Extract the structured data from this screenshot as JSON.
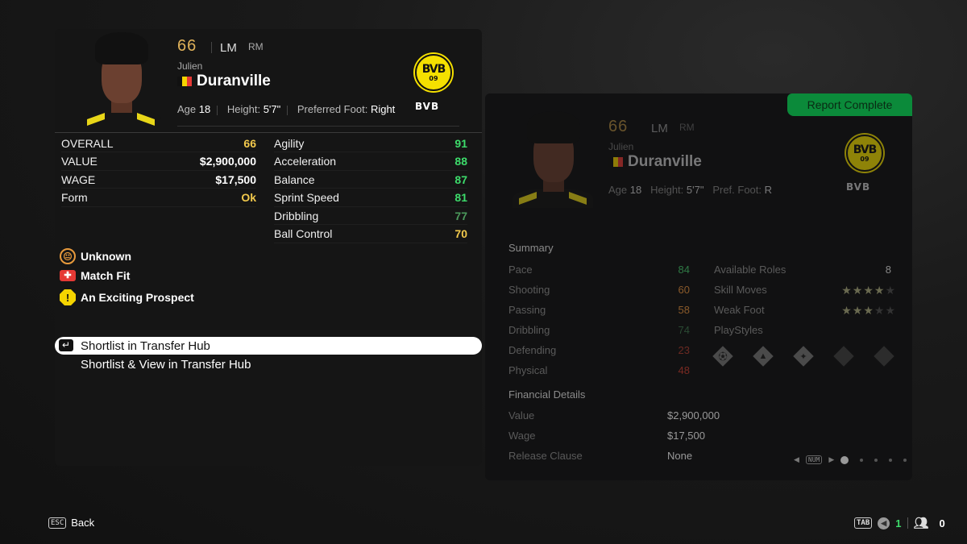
{
  "player": {
    "rating": "66",
    "position_main": "LM",
    "position_alt": "RM",
    "first_name": "Julien",
    "last_name": "Duranville",
    "nationality_flag": [
      "#111111",
      "#f5d400",
      "#e53935"
    ],
    "age_label": "Age",
    "age": "18",
    "height_label": "Height:",
    "height": "5'7\"",
    "foot_label": "Preferred Foot:",
    "foot": "Right",
    "club_abbr": "BVB",
    "club_logo_top": "BVB",
    "club_logo_bottom": "09"
  },
  "overview_stats": [
    {
      "label": "OVERALL",
      "value": "66",
      "color": "#f2c94c"
    },
    {
      "label": "VALUE",
      "value": "$2,900,000",
      "color": "#ffffff"
    },
    {
      "label": "WAGE",
      "value": "$17,500",
      "color": "#ffffff"
    },
    {
      "label": "Form",
      "value": "Ok",
      "color": "#f2c94c"
    }
  ],
  "attributes": [
    {
      "label": "Agility",
      "value": "91",
      "color": "#3ddc6b"
    },
    {
      "label": "Acceleration",
      "value": "88",
      "color": "#3ddc6b"
    },
    {
      "label": "Balance",
      "value": "87",
      "color": "#3ddc6b"
    },
    {
      "label": "Sprint Speed",
      "value": "81",
      "color": "#3ddc6b"
    },
    {
      "label": "Dribbling",
      "value": "77",
      "color": "#4c9a5c"
    },
    {
      "label": "Ball Control",
      "value": "70",
      "color": "#f2c94c"
    }
  ],
  "statuses": [
    {
      "icon": "neutral-face-icon",
      "label": "Unknown",
      "color": "#e89a3c"
    },
    {
      "icon": "ambulance-icon",
      "label": "Match Fit",
      "color": "#e53935"
    },
    {
      "icon": "warning-icon",
      "label": "An Exciting Prospect",
      "color": "#f5d400"
    }
  ],
  "actions": [
    {
      "label": "Shortlist in Transfer Hub",
      "selected": true
    },
    {
      "label": "Shortlist & View in Transfer Hub",
      "selected": false
    }
  ],
  "report": {
    "badge": "Report Complete",
    "foot_label": "Pref. Foot:",
    "foot": "R",
    "summary_title": "Summary",
    "summary": [
      {
        "label": "Pace",
        "value": "84",
        "color": "#2f7a45"
      },
      {
        "label": "Shooting",
        "value": "60",
        "color": "#8a5a2a"
      },
      {
        "label": "Passing",
        "value": "58",
        "color": "#8a5a2a"
      },
      {
        "label": "Dribbling",
        "value": "74",
        "color": "#2a4a33"
      },
      {
        "label": "Defending",
        "value": "23",
        "color": "#6b2a22"
      },
      {
        "label": "Physical",
        "value": "48",
        "color": "#7a2a22"
      }
    ],
    "available_roles_label": "Available Roles",
    "available_roles": "8",
    "skill_moves_label": "Skill Moves",
    "skill_moves": 4,
    "weak_foot_label": "Weak Foot",
    "weak_foot": 3,
    "playstyles_label": "PlayStyles",
    "playstyles": [
      "first-touch-icon",
      "rapid-icon",
      "technical-icon",
      "empty",
      "empty"
    ],
    "financial_title": "Financial Details",
    "financial": [
      {
        "label": "Value",
        "value": "$2,900,000"
      },
      {
        "label": "Wage",
        "value": "$17,500"
      },
      {
        "label": "Release Clause",
        "value": "None"
      }
    ],
    "pager_key": "NUM",
    "pages": 5,
    "current_page": 1
  },
  "footer": {
    "back_key": "ESC",
    "back_label": "Back",
    "tab_key": "TAB",
    "scout_count": "1",
    "players_count": "0"
  }
}
